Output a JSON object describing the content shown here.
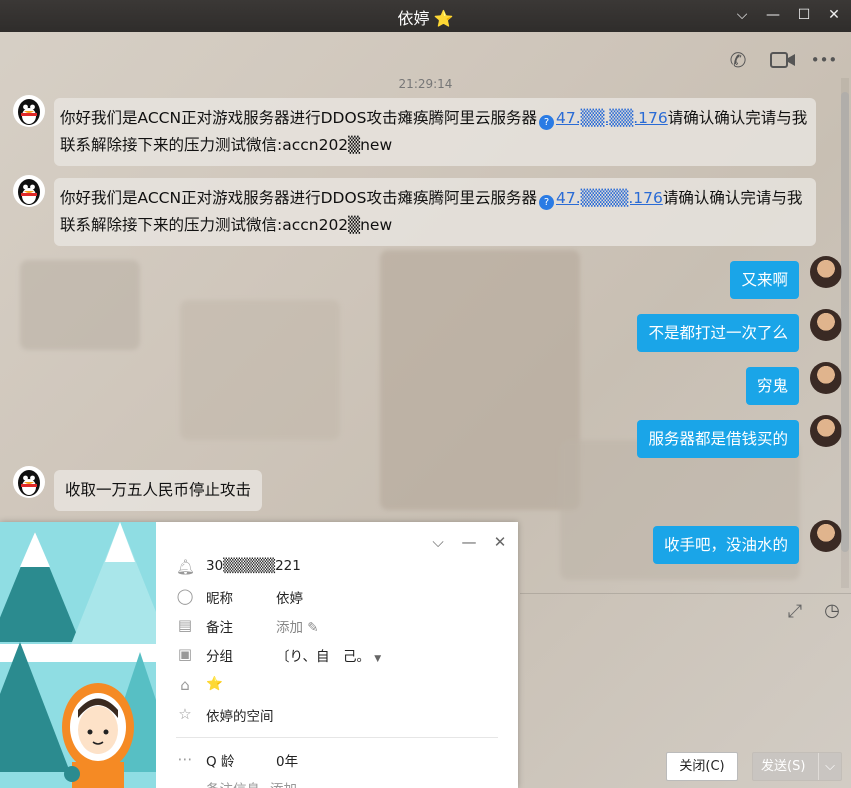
{
  "window": {
    "title": "依婷",
    "title_star": "⭐",
    "minimize": "—",
    "restore": "☐",
    "close": "✕",
    "dropdown": "⌵"
  },
  "toolbar": {
    "call_icon": "✆",
    "video_icon": "▶",
    "more_icon": "•••"
  },
  "timestamp": "21:29:14",
  "messages_incoming": [
    {
      "before": "你好我们是ACCN正对游戏服务器进行DDOS攻击瘫痪腾阿里云服务器",
      "link": "47.▒▒.▒▒.176",
      "after": "请确认确认完请与我联系解除接下来的压力测试微信:accn202▒new"
    },
    {
      "before": "你好我们是ACCN正对游戏服务器进行DDOS攻击瘫痪腾阿里云服务器",
      "link": "47.▒▒▒▒.176",
      "after": "请确认确认完请与我联系解除接下来的压力测试微信:accn202▒new"
    },
    {
      "before": "收取一万五人民币停止攻击",
      "link": "",
      "after": ""
    }
  ],
  "messages_outgoing": [
    "又来啊",
    "不是都打过一次了么",
    "穷鬼",
    "服务器都是借钱买的",
    "收手吧，没油水的"
  ],
  "input_tools": {
    "expand_icon": "⤢",
    "history_icon": "◷"
  },
  "footer": {
    "close_label": "关闭(C)",
    "send_label": "发送(S)",
    "send_dropdown": "⌵"
  },
  "profile_card": {
    "qq_number": "30▒▒▒▒▒221",
    "nickname_label": "昵称",
    "nickname_value": "依婷",
    "remark_label": "备注",
    "remark_value": "添加",
    "group_label": "分组",
    "group_value": "〔り、自　己。",
    "level_icon": "⭐",
    "space_link": "依婷的空间",
    "qq_age_label": "Q 龄",
    "qq_age_value": "0年",
    "remark_info_label": "备注信息",
    "remark_info_value": "添加"
  },
  "colors": {
    "outgoing_bubble": "#1aa5e8",
    "link": "#2a6bd5",
    "titlebar": "#2f2d2b"
  }
}
